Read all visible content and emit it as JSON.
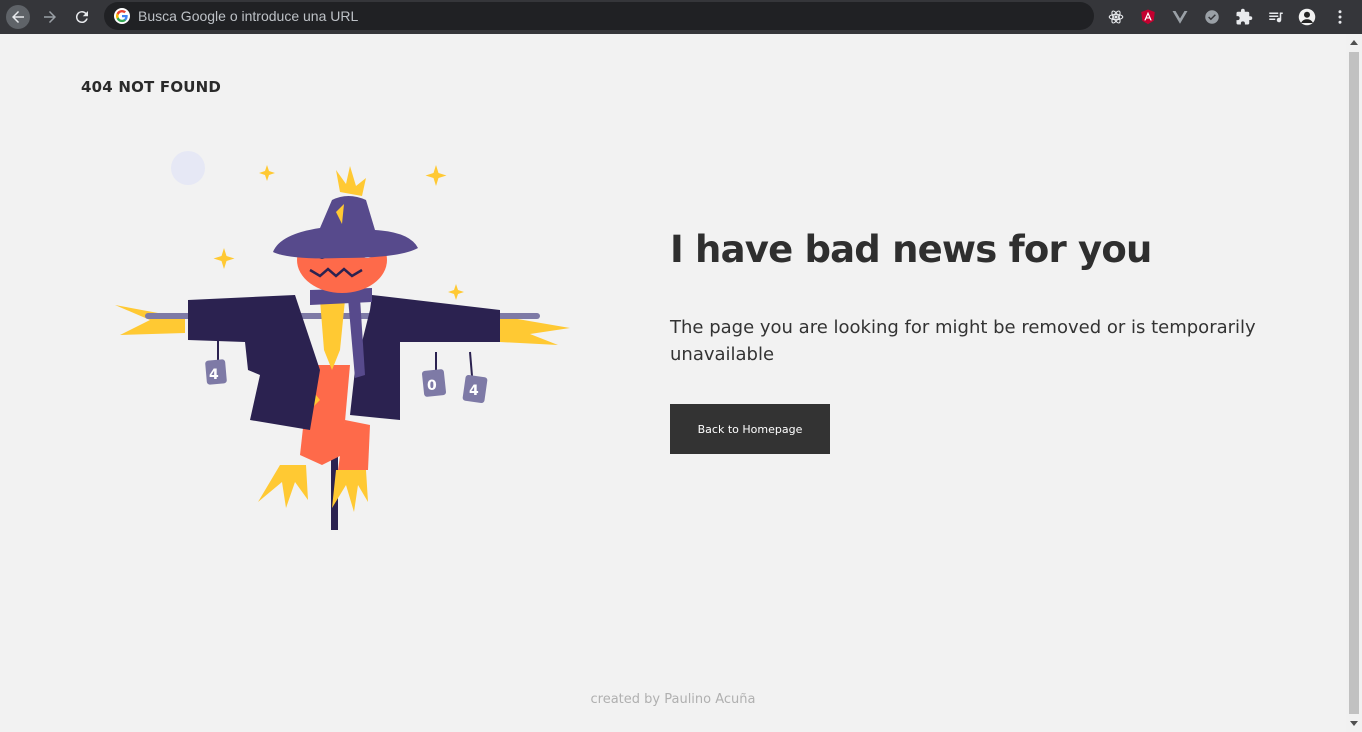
{
  "browser": {
    "omnibox_placeholder": "Busca Google o introduce una URL",
    "extensions": [
      "react-devtools-icon",
      "angular-icon",
      "vue-devtools-icon",
      "checkmark-extension-icon",
      "puzzle-extensions-icon",
      "media-playlist-icon",
      "profile-avatar",
      "more-menu-icon"
    ]
  },
  "page": {
    "brand": "404 NOT FOUND",
    "headline": "I have bad news for you",
    "message": "The page you are looking for might be removed or is temporarily unavailable",
    "button_label": "Back to Homepage",
    "footer": "created by Paulino Acuña",
    "cans": [
      "4",
      "0",
      "4"
    ]
  },
  "colors": {
    "background": "#f2f2f2",
    "button": "#333333",
    "scarecrow_coat": "#2b2250",
    "scarecrow_head": "#fe6a4a",
    "straw": "#ffc933",
    "hat": "#574a8c"
  }
}
